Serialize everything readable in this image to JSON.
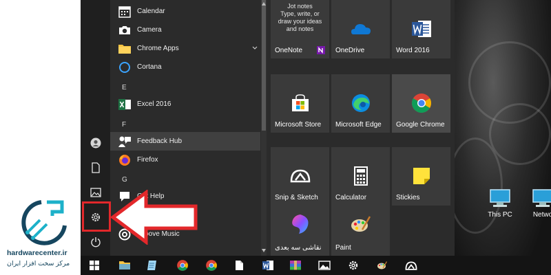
{
  "watermark": {
    "site": "hardwarecenter.ir",
    "tagline": "مرکز سخت افزار ایران"
  },
  "app_list": [
    {
      "label": "Calendar",
      "icon": "calendar-icon"
    },
    {
      "label": "Camera",
      "icon": "camera-icon"
    },
    {
      "label": "Chrome Apps",
      "icon": "folder-icon",
      "expandable": true
    },
    {
      "label": "Cortana",
      "icon": "cortana-icon"
    },
    {
      "group": "E"
    },
    {
      "label": "Excel 2016",
      "icon": "excel-icon"
    },
    {
      "group": "F"
    },
    {
      "label": "Feedback Hub",
      "icon": "feedback-hub-icon",
      "highlighted": true
    },
    {
      "label": "Firefox",
      "icon": "firefox-icon"
    },
    {
      "group": "G"
    },
    {
      "label": "Get Help",
      "icon": "get-help-icon"
    },
    {
      "label": "Groove Music",
      "icon": "groove-music-icon"
    }
  ],
  "rail": [
    "user-icon",
    "documents-icon",
    "pictures-icon",
    "settings-icon",
    "power-icon"
  ],
  "tiles": [
    {
      "label": "OneNote",
      "note": "Jot notes\nType, write, or\ndraw your ideas\nand notes",
      "icon": "onenote-icon"
    },
    {
      "label": "OneDrive",
      "icon": "onedrive-icon"
    },
    {
      "label": "Word 2016",
      "icon": "word-icon"
    },
    {
      "label": "Microsoft Store",
      "icon": "store-icon"
    },
    {
      "label": "Microsoft Edge",
      "icon": "edge-icon"
    },
    {
      "label": "Google Chrome",
      "icon": "chrome-icon"
    },
    {
      "label": "Snip & Sketch",
      "icon": "snip-sketch-icon"
    },
    {
      "label": "Calculator",
      "icon": "calculator-icon"
    },
    {
      "label": "Stickies",
      "icon": "stickies-icon"
    },
    {
      "label": "نقاشی سه بعدی",
      "icon": "paint3d-icon"
    },
    {
      "label": "Paint",
      "icon": "paint-icon"
    }
  ],
  "desktop_icons": [
    {
      "label": "This PC",
      "icon": "this-pc-icon"
    },
    {
      "label": "Netwo",
      "icon": "network-icon"
    }
  ],
  "taskbar": [
    "start-icon",
    "file-explorer-icon",
    "notepad-icon",
    "chrome-icon",
    "chrome-icon",
    "document-icon",
    "word-icon",
    "winrar-icon",
    "photos-icon",
    "settings-icon",
    "paint-icon",
    "snip-sketch-icon"
  ],
  "colors": {
    "menu_bg": "#2b2b2b",
    "rail_bg": "#1f1f1f",
    "tile_bg": "#3a3a3a",
    "taskbar_bg": "#141414",
    "annotation_red": "#e3282b",
    "logo_blue": "#16465f"
  }
}
